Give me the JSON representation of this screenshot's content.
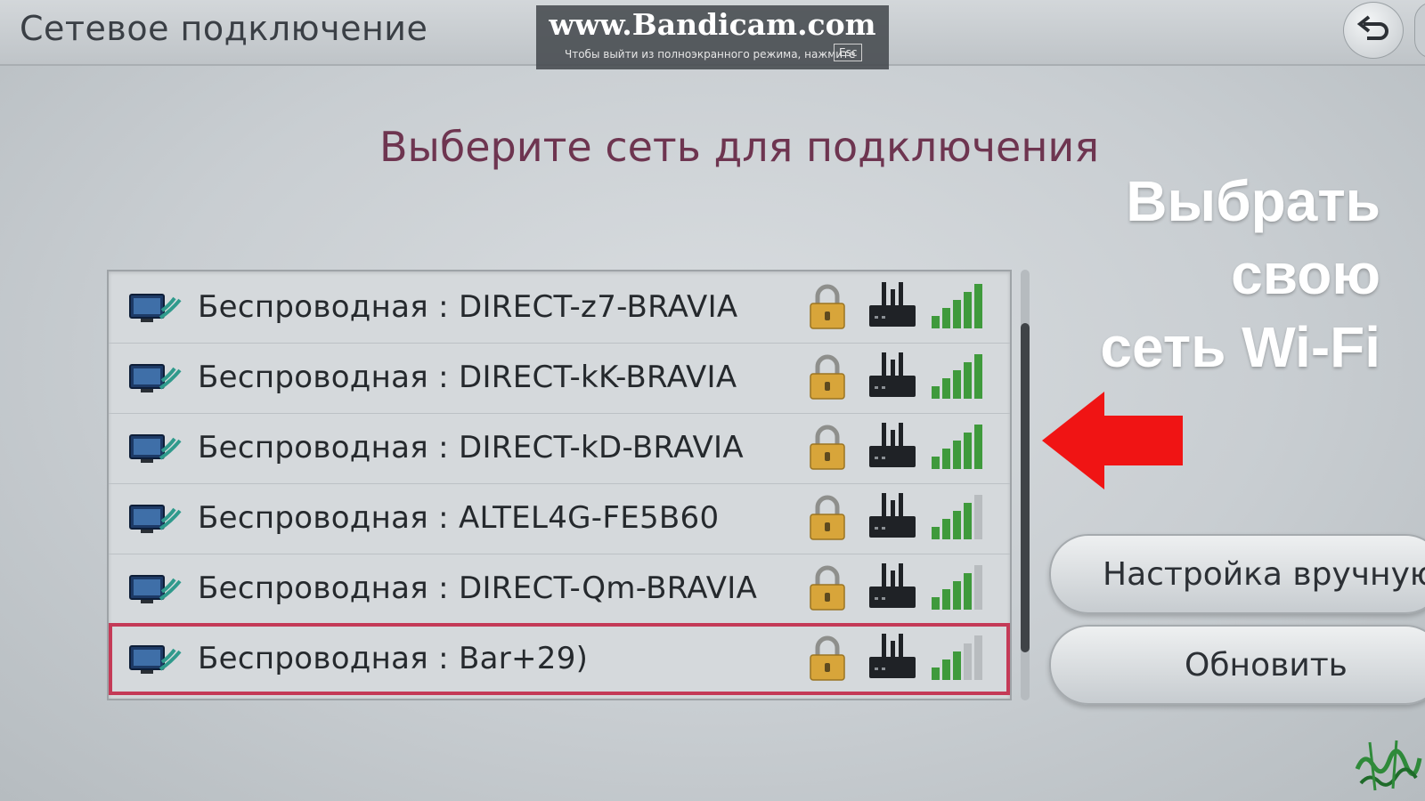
{
  "header": {
    "title": "Сетевое подключение"
  },
  "watermark": {
    "brand": "www.Bandicam.com",
    "hint": "Чтобы выйти из полноэкранного режима, нажмите",
    "key": "Esc"
  },
  "main": {
    "heading": "Выберите сеть для подключения",
    "networks": [
      {
        "label": "Беспроводная : DIRECT-z7-BRAVIA",
        "secured": true,
        "signal_bars": 5
      },
      {
        "label": "Беспроводная : DIRECT-kK-BRAVIA",
        "secured": true,
        "signal_bars": 5
      },
      {
        "label": "Беспроводная : DIRECT-kD-BRAVIA",
        "secured": true,
        "signal_bars": 5
      },
      {
        "label": "Беспроводная : ALTEL4G-FE5B60",
        "secured": true,
        "signal_bars": 4
      },
      {
        "label": "Беспроводная : DIRECT-Qm-BRAVIA",
        "secured": true,
        "signal_bars": 4
      },
      {
        "label": "Беспроводная : Bar+29)",
        "secured": true,
        "signal_bars": 3
      }
    ],
    "selected_index": 5
  },
  "sidebar": {
    "manual_label": "Настройка вручную",
    "refresh_label": "Обновить"
  },
  "overlay": {
    "callout_lines": [
      "Выбрать",
      "свою",
      "сеть Wi-Fi"
    ]
  },
  "colors": {
    "heading": "#6e3550",
    "selection_border": "#c43a57",
    "arrow": "#f01414",
    "signal_on": "#3f9a3c",
    "signal_off": "#b8bcbf",
    "lock": "#d8a53a"
  },
  "icons": {
    "row_network": "tv-wifi-icon",
    "row_lock": "lock-icon",
    "row_router": "router-icon",
    "row_signal": "signal-strength-icon",
    "back": "back-arrow-icon",
    "pointer": "left-arrow-icon"
  }
}
